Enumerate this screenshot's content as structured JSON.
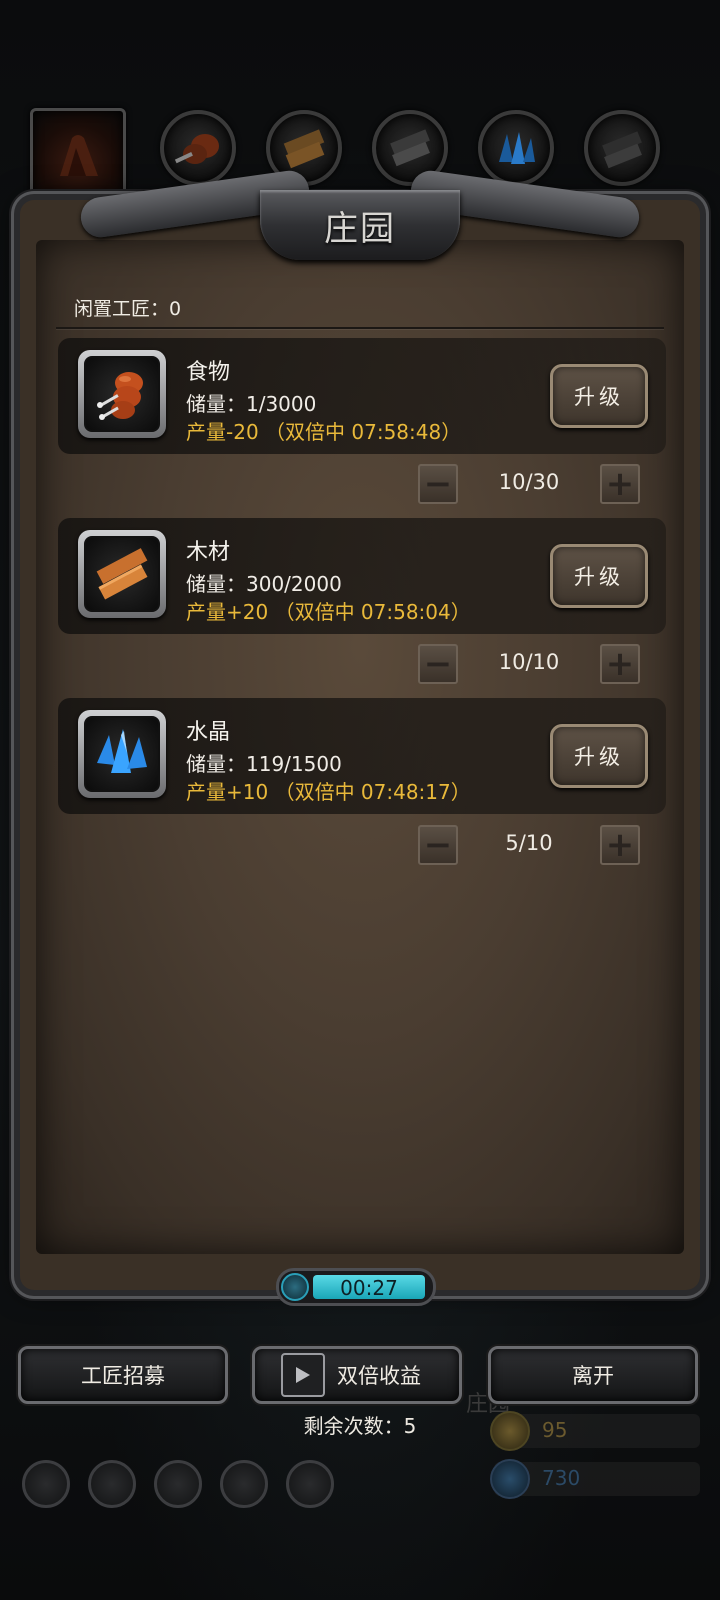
{
  "title": "庄园",
  "idle_workers": "闲置工匠：0",
  "tabs": [
    {
      "name": "estate-icon"
    },
    {
      "name": "food-icon"
    },
    {
      "name": "wood-icon"
    },
    {
      "name": "iron-icon"
    },
    {
      "name": "crystal-icon"
    },
    {
      "name": "steel-icon"
    }
  ],
  "resources": [
    {
      "name": "食物",
      "storage": "储量：1/3000",
      "production": "产量-20 （双倍中 07:58:48）",
      "workers": "10/30",
      "upgrade": "升级",
      "icon": "meat-icon"
    },
    {
      "name": "木材",
      "storage": "储量：300/2000",
      "production": "产量+20 （双倍中 07:58:04）",
      "workers": "10/10",
      "upgrade": "升级",
      "icon": "wood-planks-icon"
    },
    {
      "name": "水晶",
      "storage": "储量：119/1500",
      "production": "产量+10 （双倍中 07:48:17）",
      "workers": "5/10",
      "upgrade": "升级",
      "icon": "crystal-icon"
    }
  ],
  "stepper": {
    "minus": "−",
    "plus": "+"
  },
  "timer": "00:27",
  "buttons": {
    "recruit": "工匠招募",
    "double": "双倍收益",
    "leave": "离开"
  },
  "remaining": "剩余次数：5",
  "background_hud": {
    "estate_label": "庄园",
    "gold": "95",
    "gems": "730"
  },
  "colors": {
    "production": "#e9b93a",
    "timer_bar": "#3cc6d6",
    "parchment": "#4a3d31"
  }
}
